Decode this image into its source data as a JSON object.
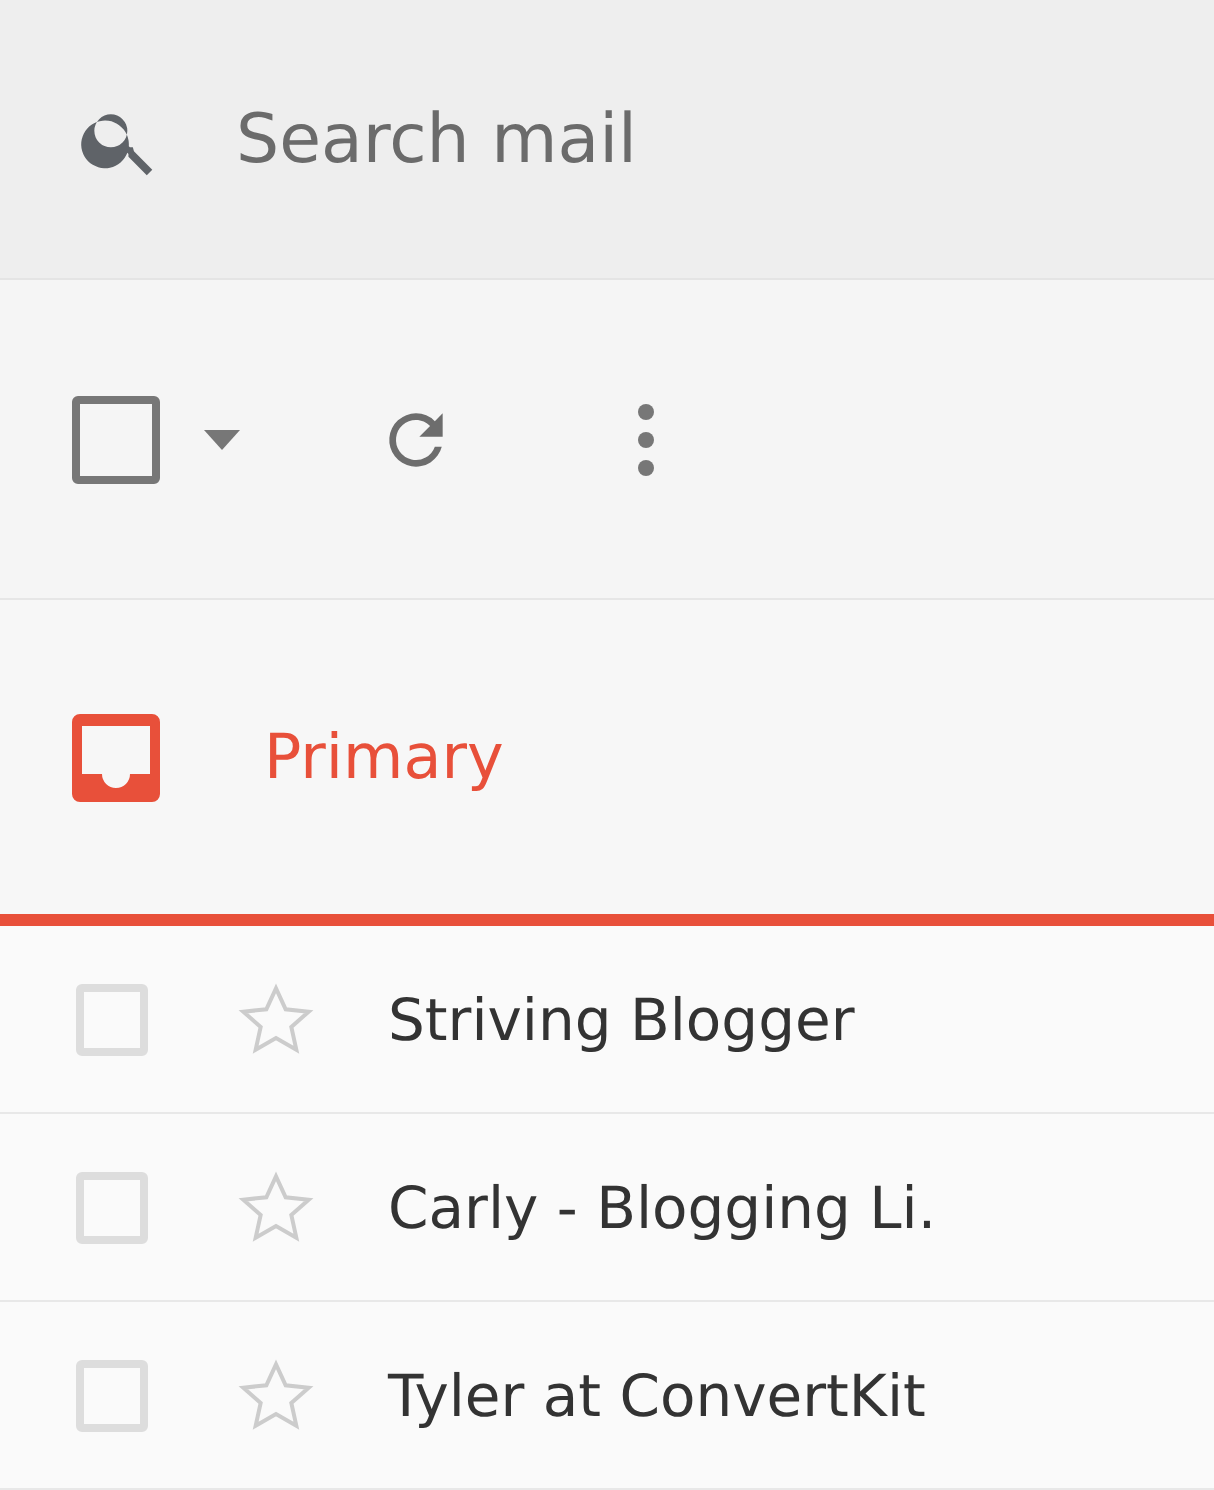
{
  "search": {
    "placeholder": "Search mail"
  },
  "toolbar": {
    "select_all": {
      "checked": false
    }
  },
  "tabs": [
    {
      "label": "Primary",
      "selected": true
    }
  ],
  "messages": [
    {
      "sender": "Striving Blogger",
      "checked": false,
      "starred": false
    },
    {
      "sender": "Carly - Blogging Li.",
      "checked": false,
      "starred": false
    },
    {
      "sender": "Tyler at ConvertKit",
      "checked": false,
      "starred": false
    }
  ]
}
